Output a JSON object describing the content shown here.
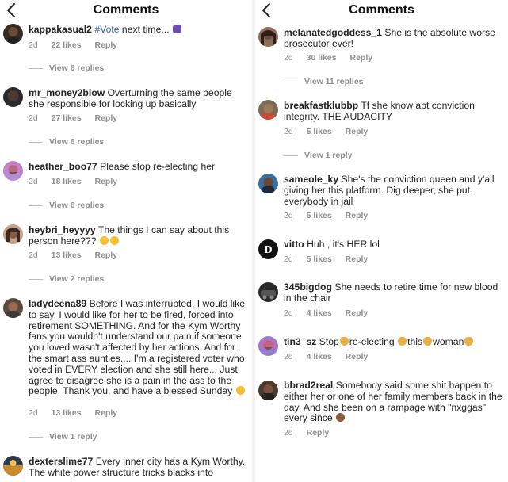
{
  "left": {
    "title": "Comments",
    "comments": [
      {
        "user": "kappakasual2",
        "tag": "#Vote",
        "text": " next time...",
        "time": "2d",
        "likes": "22 likes",
        "reply": "Reply",
        "replies": "View 6 replies"
      },
      {
        "user": "mr_money2blow",
        "text": "Overturning the same people she responsible for locking up basically",
        "time": "2d",
        "likes": "27 likes",
        "reply": "Reply",
        "replies": "View 6 replies"
      },
      {
        "user": "heather_boo77",
        "text": "Please stop re-electing her",
        "time": "2d",
        "likes": "18 likes",
        "reply": "Reply",
        "replies": "View 6 replies"
      },
      {
        "user": "heybri_heyyyy",
        "text": "The things I can say about this person here???",
        "time": "2d",
        "likes": "13 likes",
        "reply": "Reply",
        "replies": "View 2 replies"
      },
      {
        "user": "ladydeena89",
        "text": "Before I was interrupted, I would like to say, I would like for her to be fired, forced into retirement SOMETHING. And for the Kym Worthy fans you wouldn't understand our pain if someone you loved wasn't affected by her actions. And for the smart ass aunties.... I'm a registered voter who voted in EVERY election and she still here... Just agree to disagree she is a pain in the ass to the people. Thank you, and have a blessed Sunday",
        "time": "2d",
        "likes": "13 likes",
        "reply": "Reply",
        "replies": "View 1 reply"
      },
      {
        "user": "dexterslime77",
        "text": "Every inner city has a Kym Worthy. The white power structure tricks blacks into"
      }
    ]
  },
  "right": {
    "title": "Comments",
    "comments": [
      {
        "user": "melanatedgoddess_1",
        "text": "She is the absolute worse prosecutor ever!",
        "time": "2d",
        "likes": "30 likes",
        "reply": "Reply",
        "replies": "View 11 replies"
      },
      {
        "user": "breakfastklubbp",
        "text": "Tf she know abt conviction integrity. THE AUDACITY",
        "time": "2d",
        "likes": "5 likes",
        "reply": "Reply",
        "replies": "View 1 reply"
      },
      {
        "user": "sameole_ky",
        "text": "She's the conviction queen and y'all giving her this platform. Dig deeper, she put everybody in jail",
        "time": "2d",
        "likes": "5 likes",
        "reply": "Reply"
      },
      {
        "user": "vitto",
        "text": "Huh , it's HER lol",
        "time": "2d",
        "likes": "5 likes",
        "reply": "Reply"
      },
      {
        "user": "345bigdog",
        "text": "She needs to retire time for new blood in the chair",
        "time": "2d",
        "likes": "4 likes",
        "reply": "Reply"
      },
      {
        "user": "tin3_sz",
        "text_parts": [
          "Stop",
          "re-electing",
          "this",
          "woman"
        ],
        "time": "2d",
        "likes": "4 likes",
        "reply": "Reply"
      },
      {
        "user": "bbrad2real",
        "text": "Somebody said some shit happen to either her or one of her family members back in the day. And she been on a rampage with \"nxggas\" every since",
        "time": "2d",
        "reply": "Reply"
      }
    ]
  },
  "icons": {
    "back": "chevron-left-icon"
  },
  "colors": {
    "text": "#262626",
    "muted": "#8e8e8e",
    "hashtag": "#2b5ea7"
  }
}
